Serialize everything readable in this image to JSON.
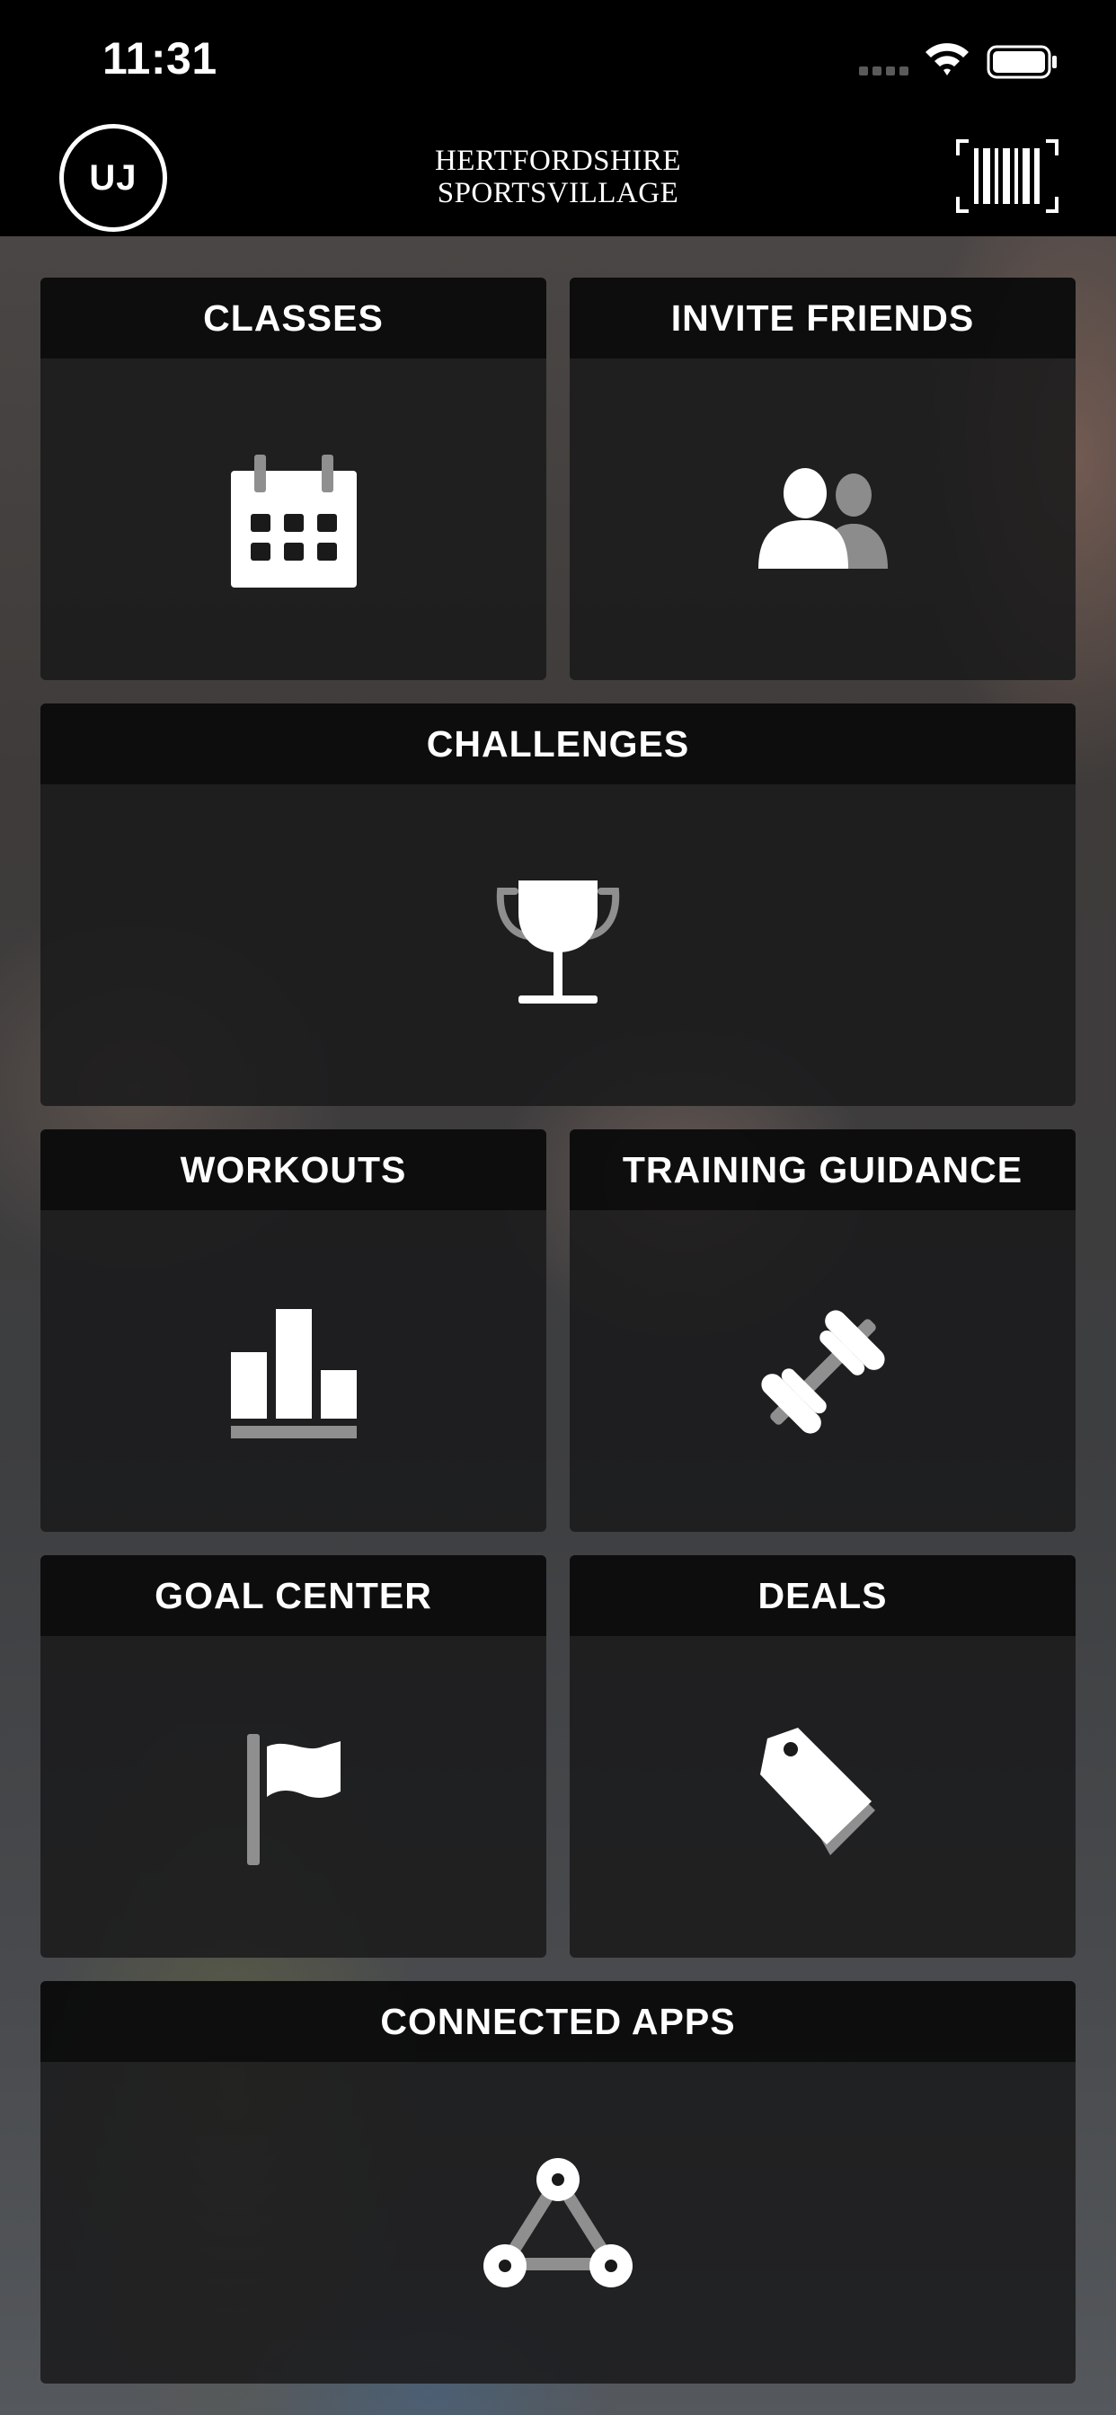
{
  "status_bar": {
    "time": "11:31"
  },
  "header": {
    "avatar_initials": "UJ",
    "brand_line1": "HERTFORDSHIRE",
    "brand_line2": "SPORTSVILLAGE",
    "barcode_icon": "barcode-icon"
  },
  "tiles": [
    {
      "label": "CLASSES",
      "icon": "calendar-icon"
    },
    {
      "label": "INVITE FRIENDS",
      "icon": "friends-icon"
    },
    {
      "label": "CHALLENGES",
      "icon": "trophy-icon"
    },
    {
      "label": "WORKOUTS",
      "icon": "bar-chart-icon"
    },
    {
      "label": "TRAINING GUIDANCE",
      "icon": "dumbbell-icon"
    },
    {
      "label": "GOAL CENTER",
      "icon": "flag-icon"
    },
    {
      "label": "DEALS",
      "icon": "tag-icon"
    },
    {
      "label": "CONNECTED APPS",
      "icon": "connected-nodes-icon"
    }
  ],
  "colors": {
    "background": "#000000",
    "tile": "#1a1a1b",
    "tile_header": "#0a0a0a",
    "icon_primary": "#ffffff",
    "icon_secondary": "#9a9a9a"
  }
}
